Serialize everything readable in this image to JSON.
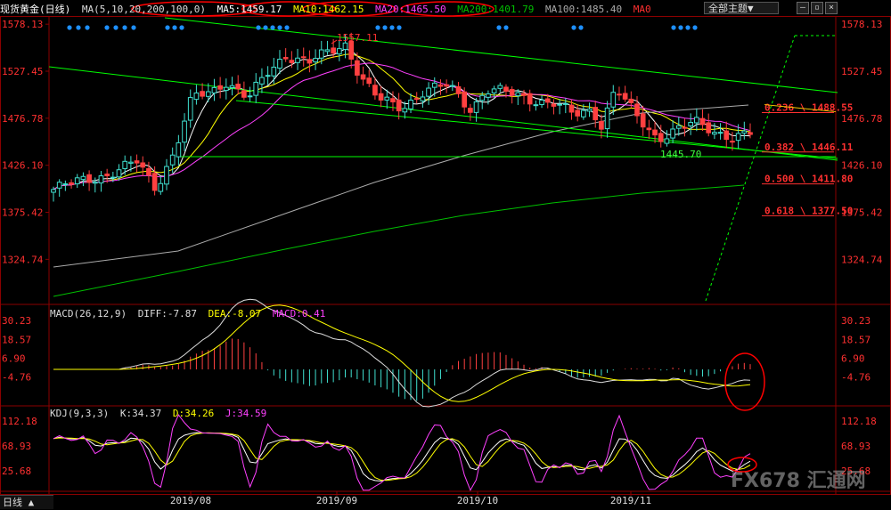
{
  "header": {
    "symbol": "现货黄金",
    "period": "(日线)",
    "ma_params": "MA(5,10,20,200,100,0)",
    "ma5": "MA5:1459.17",
    "ma10": "MA10:1462.15",
    "ma20": "MA20:1465.50",
    "ma200": "MA200:1401.79",
    "ma100": "MA100:1485.40",
    "ma0": "MA0",
    "theme_menu": "全部主题▼"
  },
  "macd_header": {
    "params": "MACD(26,12,9)",
    "diff": "DIFF:-7.87",
    "dea": "DEA:-8.07",
    "macd": "MACD:0.41"
  },
  "kdj_header": {
    "params": "KDJ(9,3,3)",
    "k": "K:34.37",
    "d": "D:34.26",
    "j": "J:34.59"
  },
  "bottom_tab": "日线 ▲",
  "logo_text": "FX678 汇通网",
  "colors": {
    "up": "#40e0d0",
    "down": "#ff4040",
    "ma5": "#ffffff",
    "ma10": "#ffff00",
    "ma20": "#ff40ff",
    "ma200": "#00c000",
    "ma100": "#aaaaaa",
    "trend": "#00ff00",
    "fib": "#ff3030",
    "circle": "#ff0000"
  },
  "chart_data": [
    {
      "type": "candlestick",
      "title": "现货黄金(日线)",
      "ylim": [
        1280,
        1585
      ],
      "y_ticks": [
        "1578.13",
        "1527.45",
        "1476.78",
        "1426.10",
        "1375.42",
        "1324.74"
      ],
      "x_ticks": [
        "2019/08",
        "2019/09",
        "2019/10",
        "2019/11"
      ],
      "annotations": [
        {
          "text": "1557.11",
          "price": 1557.11
        },
        {
          "text": "1445.70",
          "price": 1445.7
        }
      ],
      "fib_levels": [
        {
          "label": "0.236",
          "value": "1488.55",
          "price": 1488.55
        },
        {
          "label": "0.382",
          "value": "1446.11",
          "price": 1446.11
        },
        {
          "label": "0.500",
          "value": "1411.80",
          "price": 1411.8
        },
        {
          "label": "0.618",
          "value": "1377.50",
          "price": 1377.5
        }
      ]
    },
    {
      "type": "line",
      "title": "MACD(26,12,9)",
      "ylim": [
        -22,
        38
      ],
      "y_ticks": [
        "30.23",
        "18.57",
        "6.90",
        "-4.76"
      ],
      "series": [
        {
          "name": "DIFF",
          "last": -7.87
        },
        {
          "name": "DEA",
          "last": -8.07
        },
        {
          "name": "MACD",
          "last": 0.41
        }
      ]
    },
    {
      "type": "line",
      "title": "KDJ(9,3,3)",
      "ylim": [
        -10,
        135
      ],
      "y_ticks": [
        "112.18",
        "68.93",
        "25.68"
      ],
      "series": [
        {
          "name": "K",
          "last": 34.37
        },
        {
          "name": "D",
          "last": 34.26
        },
        {
          "name": "J",
          "last": 34.59
        }
      ]
    }
  ]
}
